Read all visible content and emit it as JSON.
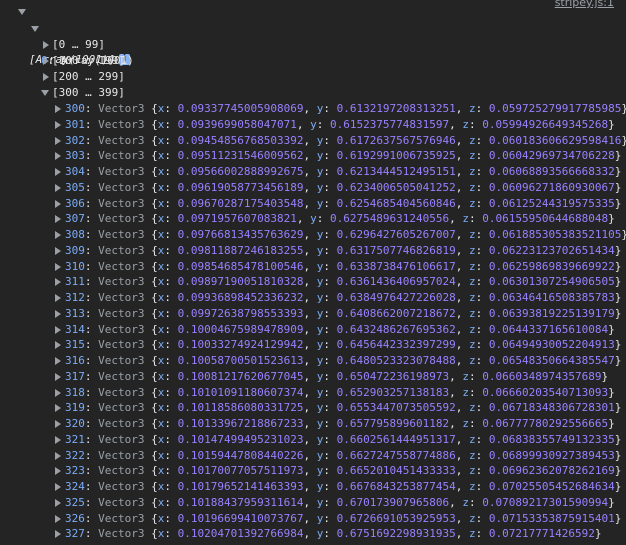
{
  "header": {
    "source_link": "stripey.js:1",
    "root_label": "[Array(1001)]",
    "info_badge": "i"
  },
  "array": {
    "index": "0",
    "label": "Array(1001)"
  },
  "ranges": [
    {
      "label": "[0 … 99]",
      "expanded": false
    },
    {
      "label": "[100 … 199]",
      "expanded": false
    },
    {
      "label": "[200 … 299]",
      "expanded": false
    },
    {
      "label": "[300 … 399]",
      "expanded": true
    }
  ],
  "type_name": "Vector3",
  "items": [
    {
      "i": "300",
      "x": "0.09337745005908069",
      "y": "0.6132197208313251",
      "z": "0.059725279917785985"
    },
    {
      "i": "301",
      "x": "0.0939699058047071",
      "y": "0.6152375774831597",
      "z": "0.05994926649345268"
    },
    {
      "i": "302",
      "x": "0.09454856768503392",
      "y": "0.6172637567576946",
      "z": "0.060183606629598416"
    },
    {
      "i": "303",
      "x": "0.09511231546009562",
      "y": "0.6192991006735925",
      "z": "0.06042969734706228"
    },
    {
      "i": "304",
      "x": "0.09566002888992675",
      "y": "0.6213444512495151",
      "z": "0.06068893566668332"
    },
    {
      "i": "305",
      "x": "0.09619058773456189",
      "y": "0.6234006505041252",
      "z": "0.06096271860930067"
    },
    {
      "i": "306",
      "x": "0.09670287175403548",
      "y": "0.6254685404560846",
      "z": "0.06125244319575335"
    },
    {
      "i": "307",
      "x": "0.0971957607083821",
      "y": "0.6275489631240556",
      "z": "0.06155950644688048"
    },
    {
      "i": "308",
      "x": "0.09766813435763629",
      "y": "0.6296427605267007",
      "z": "0.061885305383521105"
    },
    {
      "i": "309",
      "x": "0.09811887246183255",
      "y": "0.6317507746826819",
      "z": "0.06223123702651434"
    },
    {
      "i": "310",
      "x": "0.09854685478100546",
      "y": "0.6338738476106617",
      "z": "0.06259869839669922"
    },
    {
      "i": "311",
      "x": "0.09897190051810328",
      "y": "0.6361436406957024",
      "z": "0.06301307254906505"
    },
    {
      "i": "312",
      "x": "0.09936898452336232",
      "y": "0.6384976427226028",
      "z": "0.06346416508385783"
    },
    {
      "i": "313",
      "x": "0.09972638798553393",
      "y": "0.6408662007218672",
      "z": "0.06393819225139179"
    },
    {
      "i": "314",
      "x": "0.10004675989478909",
      "y": "0.6432486267695362",
      "z": "0.0644337165610084"
    },
    {
      "i": "315",
      "x": "0.10033274924129942",
      "y": "0.6456442332397299",
      "z": "0.06494930052204913"
    },
    {
      "i": "316",
      "x": "0.10058700501523613",
      "y": "0.6480523323078488",
      "z": "0.06548350664385547"
    },
    {
      "i": "317",
      "x": "0.10081217620677045",
      "y": "0.650472236198973",
      "z": "0.0660348974357689"
    },
    {
      "i": "318",
      "x": "0.10101091180607374",
      "y": "0.652903257138183",
      "z": "0.06660203540713093"
    },
    {
      "i": "319",
      "x": "0.10118586080331725",
      "y": "0.6553447073505592",
      "z": "0.06718348306728301"
    },
    {
      "i": "320",
      "x": "0.10133967218867233",
      "y": "0.657795899601182",
      "z": "0.06777780292556665"
    },
    {
      "i": "321",
      "x": "0.10147499495231023",
      "y": "0.6602561444951317",
      "z": "0.06838355749132335"
    },
    {
      "i": "322",
      "x": "0.10159447808440226",
      "y": "0.6627247558774886",
      "z": "0.06899930927389453"
    },
    {
      "i": "323",
      "x": "0.10170077057511973",
      "y": "0.6652010451433333",
      "z": "0.06962362078262169"
    },
    {
      "i": "324",
      "x": "0.10179652141463393",
      "y": "0.6676843253877454",
      "z": "0.07025505452684634"
    },
    {
      "i": "325",
      "x": "0.10188437959311614",
      "y": "0.670173907965806",
      "z": "0.07089217301590994"
    },
    {
      "i": "326",
      "x": "0.10196699410073767",
      "y": "0.6726691053925953",
      "z": "0.07153353875915401"
    },
    {
      "i": "327",
      "x": "0.10204701392766984",
      "y": "0.6751692298931935",
      "z": "0.07217771426592"
    }
  ]
}
